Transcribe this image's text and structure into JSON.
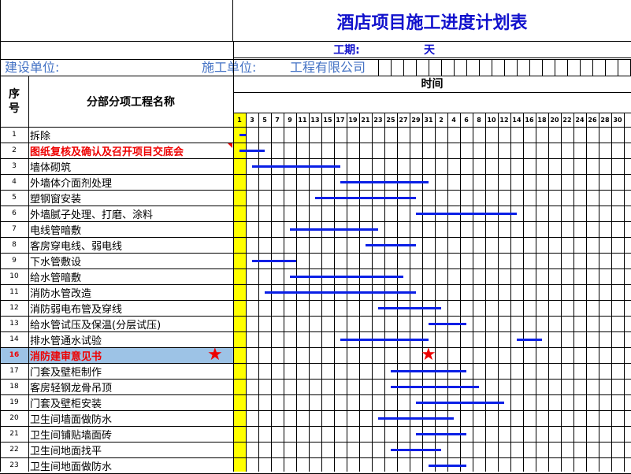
{
  "header": {
    "title": "酒店项目施工进度计划表",
    "period_label": "工期:",
    "period_unit": "天",
    "builder_label": "建设单位:",
    "contractor_label": "施工单位:",
    "contractor_name": "工程有限公司",
    "time_label": "时间",
    "seq_label": "序号",
    "name_label": "分部分项工程名称"
  },
  "days": [
    "1",
    "3",
    "5",
    "7",
    "9",
    "11",
    "13",
    "15",
    "17",
    "19",
    "21",
    "23",
    "25",
    "27",
    "29",
    "31",
    "2",
    "4",
    "6",
    "8",
    "10",
    "12",
    "14",
    "16",
    "18",
    "20",
    "22",
    "24",
    "26",
    "28",
    "30"
  ],
  "colors": {
    "title": "#1111cc",
    "info": "#4472c4",
    "bar": "#0a1fe6",
    "highlight_row": "#9dc3e6",
    "first_column": "#ffff00",
    "red": "#ee0000"
  },
  "tasks": [
    {
      "num": "1",
      "name": "拆除",
      "bar": [
        1,
        1.5
      ]
    },
    {
      "num": "2",
      "name": "图纸复核及确认及召开项目交底会",
      "bar": [
        1,
        3
      ],
      "red": true
    },
    {
      "num": "3",
      "name": "墙体砌筑",
      "bar": [
        2,
        9
      ]
    },
    {
      "num": "4",
      "name": "外墙体介面剂处理",
      "bar": [
        9,
        16
      ]
    },
    {
      "num": "5",
      "name": "塑钢窗安装",
      "bar": [
        7,
        15
      ]
    },
    {
      "num": "6",
      "name": "外墙腻子处理、打磨、涂料",
      "bar": [
        15,
        23
      ]
    },
    {
      "num": "7",
      "name": "电线管暗敷",
      "bar": [
        5,
        12
      ]
    },
    {
      "num": "8",
      "name": "客房穿电线、弱电线",
      "bar": [
        11,
        15
      ]
    },
    {
      "num": "9",
      "name": "下水管敷设",
      "bar": [
        2,
        5.5
      ]
    },
    {
      "num": "10",
      "name": "给水管暗敷",
      "bar": [
        5,
        14
      ]
    },
    {
      "num": "11",
      "name": "消防水管改造",
      "bar": [
        3,
        15
      ]
    },
    {
      "num": "12",
      "name": "消防弱电布管及穿线",
      "bar": [
        12,
        17
      ]
    },
    {
      "num": "13",
      "name": "给水管试压及保温(分层试压)",
      "bar": [
        16,
        19
      ]
    },
    {
      "num": "14",
      "name": "排水管通水试验",
      "bar": [
        9,
        16
      ],
      "bar2": [
        23,
        25
      ]
    },
    {
      "num": "16",
      "name": "消防建审意见书",
      "highlight": true,
      "star_col": 16
    },
    {
      "num": "17",
      "name": "门套及壁柜制作",
      "bar": [
        13,
        19
      ]
    },
    {
      "num": "18",
      "name": "客房轻钢龙骨吊顶",
      "bar": [
        13,
        20
      ]
    },
    {
      "num": "19",
      "name": "门套及壁柜安装",
      "bar": [
        15,
        22
      ]
    },
    {
      "num": "20",
      "name": "卫生间墙面做防水",
      "bar": [
        12,
        18
      ]
    },
    {
      "num": "21",
      "name": "卫生间铺贴墙面砖",
      "bar": [
        15,
        19
      ]
    },
    {
      "num": "22",
      "name": "卫生间地面找平",
      "bar": [
        13,
        17
      ]
    },
    {
      "num": "23",
      "name": "卫生间地面做防水",
      "bar": [
        16,
        19
      ]
    }
  ]
}
